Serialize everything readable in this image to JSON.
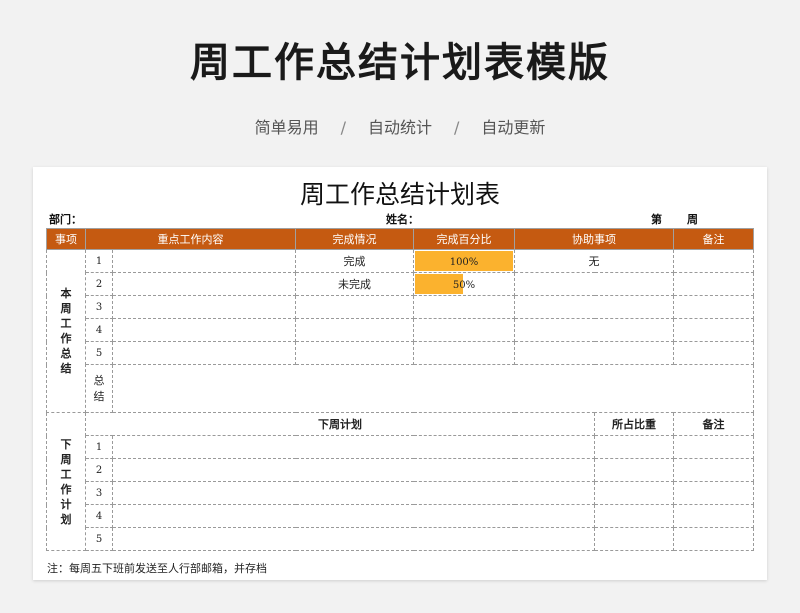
{
  "header": {
    "title": "周工作总结计划表模版",
    "tags": [
      "简单易用",
      "自动统计",
      "自动更新"
    ],
    "separator": "/"
  },
  "sheet": {
    "title": "周工作总结计划表",
    "dept_label": "部门：",
    "name_label": "姓名：",
    "week_label_prefix": "第",
    "week_label_suffix": "周",
    "columns": [
      "事项",
      "重点工作内容",
      "完成情况",
      "完成百分比",
      "协助事项",
      "备注"
    ],
    "this_week_label": "本周工作总结",
    "this_week_rows": [
      {
        "no": "1",
        "content": "",
        "status": "完成",
        "percent_text": "100%",
        "percent": 1.0,
        "assist": "无",
        "note": ""
      },
      {
        "no": "2",
        "content": "",
        "status": "未完成",
        "percent_text": "50%",
        "percent": 0.5,
        "assist": "",
        "note": ""
      },
      {
        "no": "3",
        "content": "",
        "status": "",
        "percent_text": "",
        "percent": 0,
        "assist": "",
        "note": ""
      },
      {
        "no": "4",
        "content": "",
        "status": "",
        "percent_text": "",
        "percent": 0,
        "assist": "",
        "note": ""
      },
      {
        "no": "5",
        "content": "",
        "status": "",
        "percent_text": "",
        "percent": 0,
        "assist": "",
        "note": ""
      }
    ],
    "summary_label": "总结",
    "next_week_label": "下周工作计划",
    "next_columns": [
      "下周计划",
      "所占比重",
      "备注"
    ],
    "next_rows": [
      "1",
      "2",
      "3",
      "4",
      "5"
    ],
    "note": "注：每周五下班前发送至人行部邮箱，并存档",
    "colors": {
      "header_bg": "#c55a11",
      "bar": "#fbb22e"
    }
  }
}
